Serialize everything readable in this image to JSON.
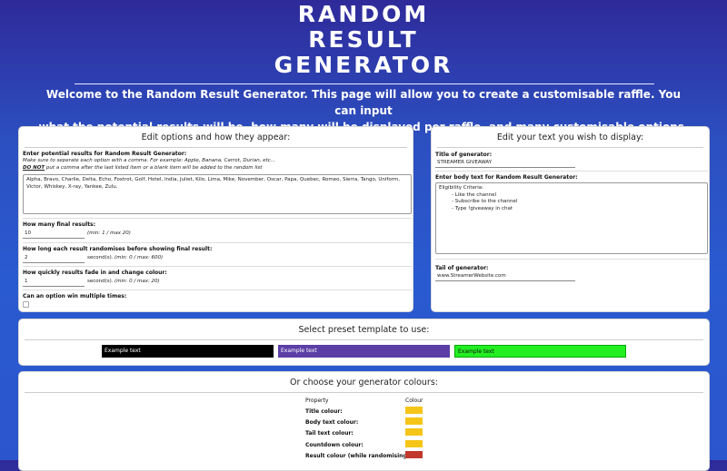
{
  "header": {
    "title_line1": "RANDOM",
    "title_line2": "RESULT",
    "title_line3": "GENERATOR",
    "welcome_line1": "Welcome to the Random Result Generator. This page will allow you to create a customisable raffle. You can input",
    "welcome_line2": "what the potential results will be, how many will be displayed per raffle, and many customisable options."
  },
  "options_panel": {
    "heading": "Edit options and how they appear:",
    "results_label": "Enter potential results for Random Result Generator:",
    "results_note1": "Make sure to seperate each option with a comma. For example: Apple, Banana, Carrot, Durian, etc...",
    "results_note2_underlined": "DO NOT",
    "results_note2_rest": " put a comma after the last listed item or a blank item will be added to the random list",
    "results_value": "Alpha, Bravo, Charlie, Delta, Echo, Foxtrot, Golf, Hotel, India, Juliet, Kilo, Lima, Mike, November, Oscar, Papa, Quebec, Romeo, Sierra, Tango, Uniform, Victor, Whiskey, X-ray, Yankee, Zulu.",
    "final_label": "How many final results:",
    "final_value": "10",
    "final_hint": "(min: 1 / max 20)",
    "randomise_label": "How long each result randomises before showing final result:",
    "randomise_value": "2",
    "randomise_unit": "second(s).",
    "randomise_hint": "(min: 0 / max: 600)",
    "fade_label": "How quickly results fade in and change colour:",
    "fade_value": "1",
    "fade_unit": "second(s).",
    "fade_hint": "(min: 0 / max: 20)",
    "multi_label": "Can an option win multiple times:"
  },
  "text_panel": {
    "heading": "Edit your text you wish to display:",
    "title_label": "Title of generator:",
    "title_value": "STREAMER GIVEAWAY",
    "body_label": "Enter body text for Random Result Generator:",
    "body_line1": "Eligibility Criteria:",
    "body_line2": "- Like the channel",
    "body_line3": "- Subscribe to the channel",
    "body_line4": "- Type !giveaway in chat",
    "tail_label": "Tail of generator:",
    "tail_value": "www.StreamerWebsite.com"
  },
  "preset_panel": {
    "heading": "Select preset template to use:",
    "templates": [
      {
        "label": "Example text",
        "bg": "#000000",
        "fg": "#ffffff"
      },
      {
        "label": "Example text",
        "bg": "#5b3fa6",
        "fg": "#ffffff"
      },
      {
        "label": "Example text",
        "bg": "#22ee22",
        "fg": "#111111"
      }
    ]
  },
  "colours_panel": {
    "heading": "Or choose your generator colours:",
    "col_property": "Property",
    "col_colour": "Colour",
    "rows": [
      {
        "label": "Title colour:",
        "color": "#f5c518"
      },
      {
        "label": "Body text colour:",
        "color": "#f5c518"
      },
      {
        "label": "Tail text colour:",
        "color": "#f5c518"
      },
      {
        "label": "Countdown colour:",
        "color": "#f5c518"
      },
      {
        "label": "Result colour (while randomising):",
        "color": "#c0392b"
      }
    ]
  }
}
